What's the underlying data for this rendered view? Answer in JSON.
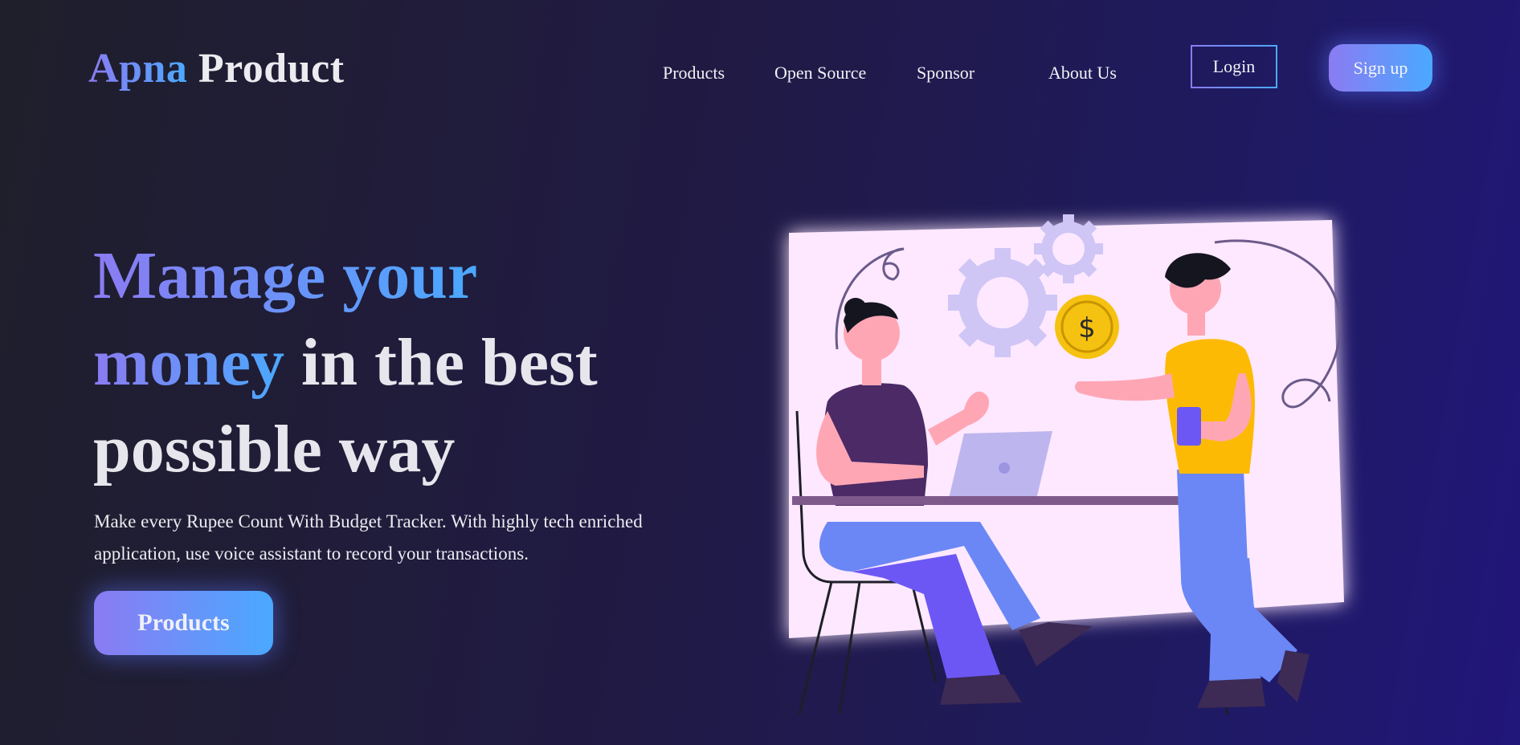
{
  "header": {
    "logo_part1": "Apna",
    "logo_part2": "Product",
    "nav": [
      {
        "label": "Products"
      },
      {
        "label": "Open Source"
      },
      {
        "label": "Sponsor"
      },
      {
        "label": "About Us"
      }
    ],
    "login_label": "Login",
    "signup_label": "Sign up"
  },
  "hero": {
    "title_grad_1": "Manage your",
    "title_grad_2": "money",
    "title_plain_2": "in the best",
    "title_plain_3": "possible way",
    "description": "Make every Rupee Count With Budget Tracker. With highly tech enriched application, use voice assistant to record your transactions.",
    "cta_label": "Products",
    "illustration_coin_symbol": "$"
  },
  "colors": {
    "gradient_start": "#8b7bf2",
    "gradient_end": "#4aa9ff",
    "background_left": "#1f1f2b",
    "background_right": "#21167a"
  }
}
